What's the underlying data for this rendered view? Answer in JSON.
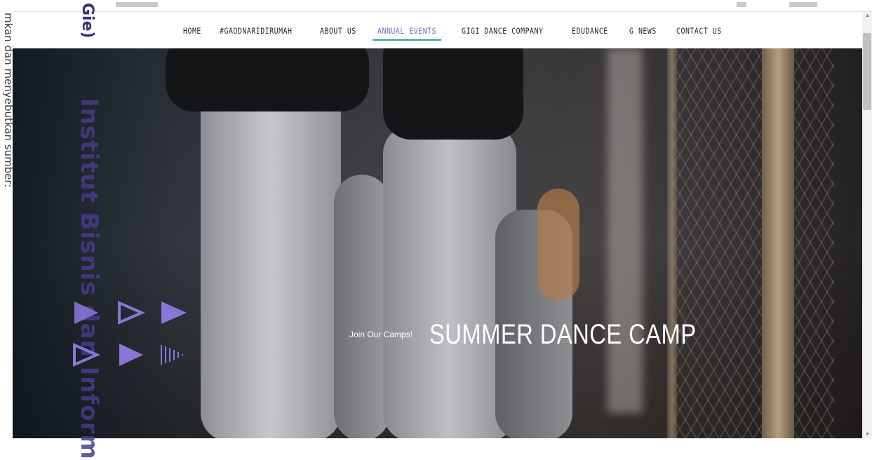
{
  "nav": {
    "items": [
      {
        "label": "HOME"
      },
      {
        "label": "#GAODNARIDIRUMAH"
      },
      {
        "label": "ABOUT US"
      },
      {
        "label": "ANNUAL EVENTS"
      },
      {
        "label": "GIGI DANCE COMPANY"
      },
      {
        "label": "EDUDANCE"
      },
      {
        "label": "G NEWS"
      },
      {
        "label": "CONTACT US"
      }
    ],
    "active_item": "ANNUAL EVENTS"
  },
  "hero": {
    "tagline": "Join Our Camps!",
    "headline": "SUMMER DANCE CAMP"
  },
  "overlay": {
    "left_margin_text": "mkan dan menyebutkan sumber:",
    "watermark_text": "Institut Bisnis dan Inform",
    "watermark_short": "Gie)"
  },
  "colors": {
    "accent_purple": "#7a68c8",
    "active_underline": "#27a99b",
    "nav_text": "#2a2a2a",
    "triangle_purple": "#8a76d6"
  }
}
